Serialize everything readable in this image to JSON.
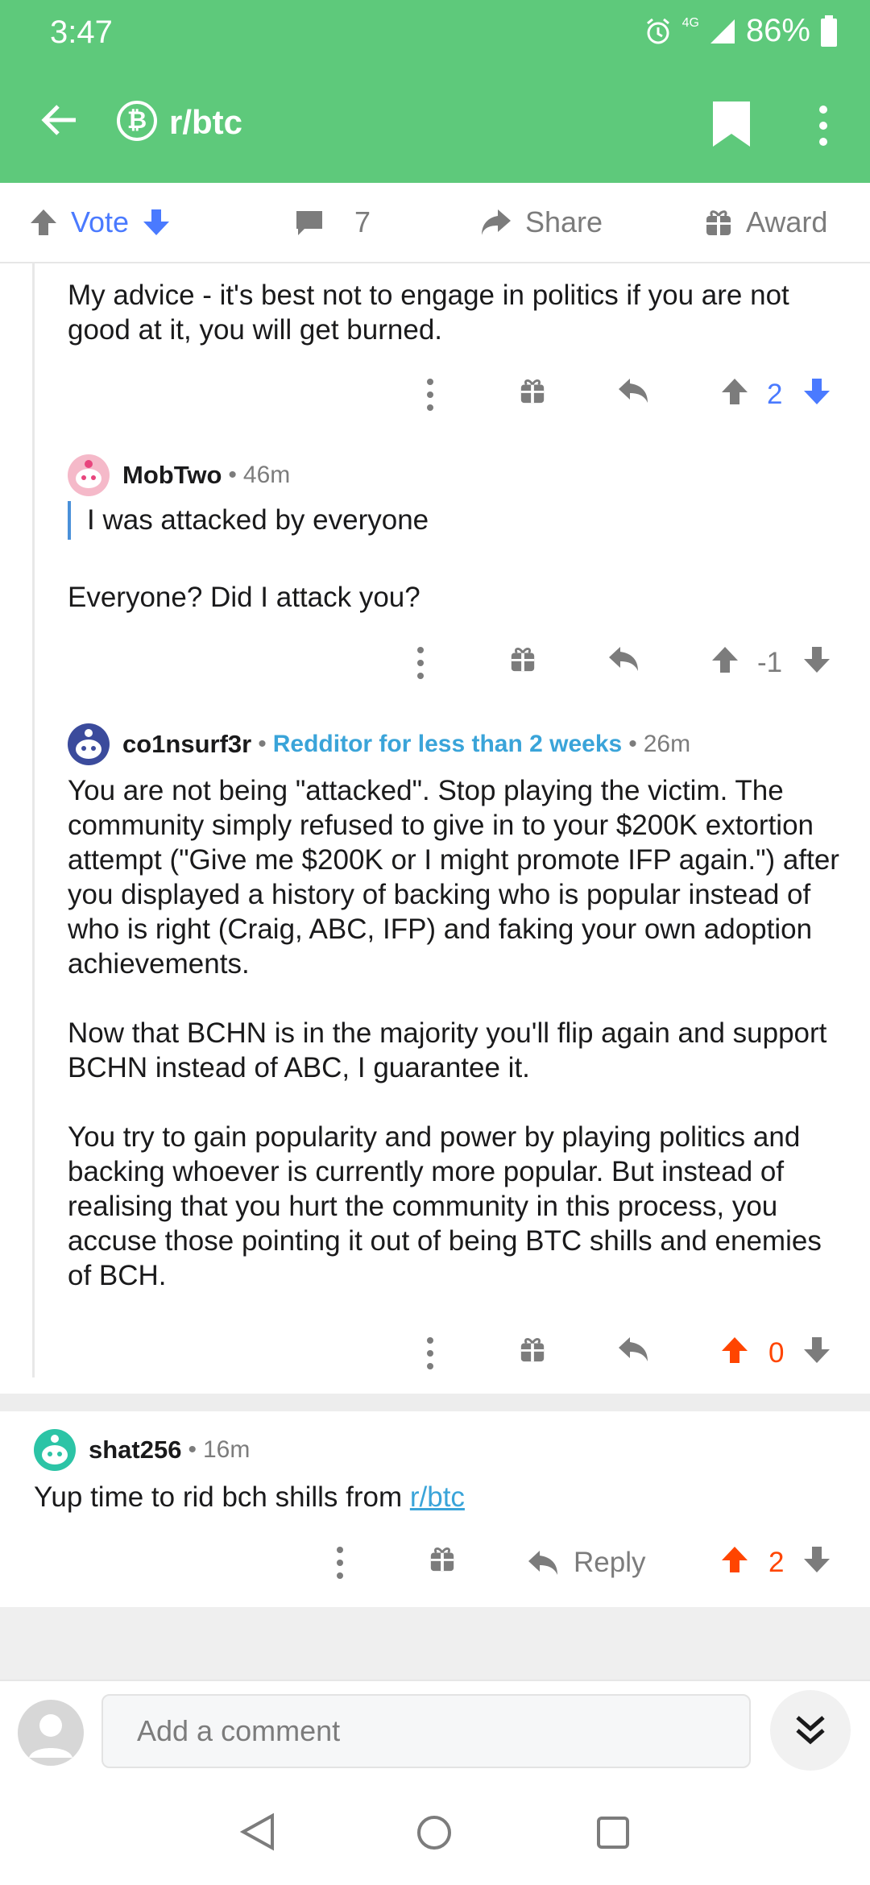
{
  "status": {
    "time": "3:47",
    "network": "4G",
    "battery": "86%"
  },
  "appbar": {
    "subreddit": "r/btc",
    "subreddit_icon": "bitcoin-icon"
  },
  "actions": {
    "vote": "Vote",
    "comments": "7",
    "share": "Share",
    "award": "Award"
  },
  "comments": [
    {
      "body": "My advice - it's best not to engage in politics if you are not good at it, you will get burned.",
      "score": "2"
    },
    {
      "author": "MobTwo",
      "time": "46m",
      "quote": "I was attacked by everyone",
      "body": "Everyone? Did I attack you?",
      "score": "-1"
    },
    {
      "author": "co1nsurf3r",
      "flair": "Redditor for less than 2 weeks",
      "time": "26m",
      "paragraphs": [
        "You are not being \"attacked\". Stop playing the victim. The community simply refused to give in to your $200K extortion attempt (\"Give me $200K or I might promote IFP again.\") after you displayed a history of backing who is popular instead of who is right (Craig, ABC, IFP) and faking your own adoption achievements.",
        "Now that BCHN is in the majority you'll flip again and support BCHN instead of ABC, I guarantee it.",
        "You try to gain popularity and power by playing politics and backing whoever is currently more popular. But instead of realising that you hurt the community in this process, you accuse those pointing it out of being BTC shills and enemies of BCH."
      ],
      "score": "0"
    },
    {
      "author": "shat256",
      "time": "16m",
      "body_prefix": "Yup time to rid bch shills from ",
      "body_link": "r/btc",
      "reply": "Reply",
      "score": "2"
    }
  ],
  "composer": {
    "placeholder": "Add a comment"
  },
  "colors": {
    "header": "#5ec97b",
    "upvote": "#ff4500",
    "downvote": "#4a7aff",
    "link": "#3aa4d9"
  }
}
